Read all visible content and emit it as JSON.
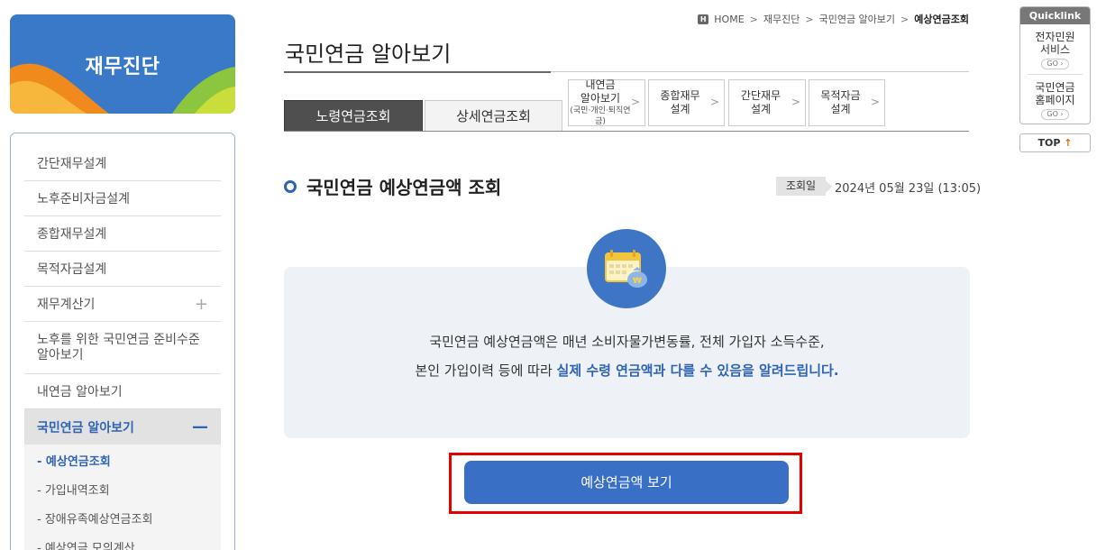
{
  "banner": {
    "title": "재무진단"
  },
  "breadcrumb": {
    "home": "HOME",
    "items": [
      "재무진단",
      "국민연금 알아보기"
    ],
    "current": "예상연금조회",
    "separator": ">"
  },
  "page_title": "국민연금 알아보기",
  "lnb": {
    "items": [
      {
        "label": "간단재무설계"
      },
      {
        "label": "노후준비자금설계"
      },
      {
        "label": "종합재무설계"
      },
      {
        "label": "목적자금설계"
      },
      {
        "label": "재무계산기",
        "expander": "+"
      },
      {
        "label": "노후를 위한 국민연금 준비수준 알아보기"
      },
      {
        "label": "내연금 알아보기"
      },
      {
        "label": "국민연금 알아보기",
        "expander": "—"
      }
    ],
    "sub_items": [
      {
        "label": "- 예상연금조회"
      },
      {
        "label": "- 가입내역조회"
      },
      {
        "label": "- 장애유족예상연금조회"
      },
      {
        "label": "- 예상연금 모의계산"
      }
    ]
  },
  "tabs": {
    "primary": [
      "노령연금조회",
      "상세연금조회"
    ],
    "quick": [
      {
        "line1": "내연금",
        "line2": "알아보기",
        "small": "(국민·개인·퇴직연금)"
      },
      {
        "line1": "종합재무",
        "line2": "설계"
      },
      {
        "line1": "간단재무",
        "line2": "설계"
      },
      {
        "line1": "목적자금",
        "line2": "설계"
      }
    ],
    "arrow": ">"
  },
  "section": {
    "title": "국민연금 예상연금액 조회",
    "date_label": "조회일",
    "date_value": "2024년 05월 23일 (13:05)"
  },
  "info": {
    "line1": "국민연금 예상연금액은 매년 소비자물가변동률, 전체 가입자 소득수준,",
    "line2_prefix": "본인 가입이력 등에 따라 ",
    "line2_highlight": "실제 수령 연금액과 다를 수 있음을 알려드립니다."
  },
  "button": {
    "label": "예상연금액 보기"
  },
  "quicklink": {
    "title": "Quicklink",
    "items": [
      {
        "line1": "전자민원",
        "line2": "서비스",
        "go": "GO ›"
      },
      {
        "line1": "국민연금",
        "line2": "홈페이지",
        "go": "GO ›"
      }
    ],
    "top_label": "TOP",
    "top_arrow": "↑"
  },
  "colors": {
    "accent": "#2f63b4",
    "button": "#3a6fc6",
    "highlight_box": "#e50000",
    "banner_bg": "#3a79c8"
  }
}
